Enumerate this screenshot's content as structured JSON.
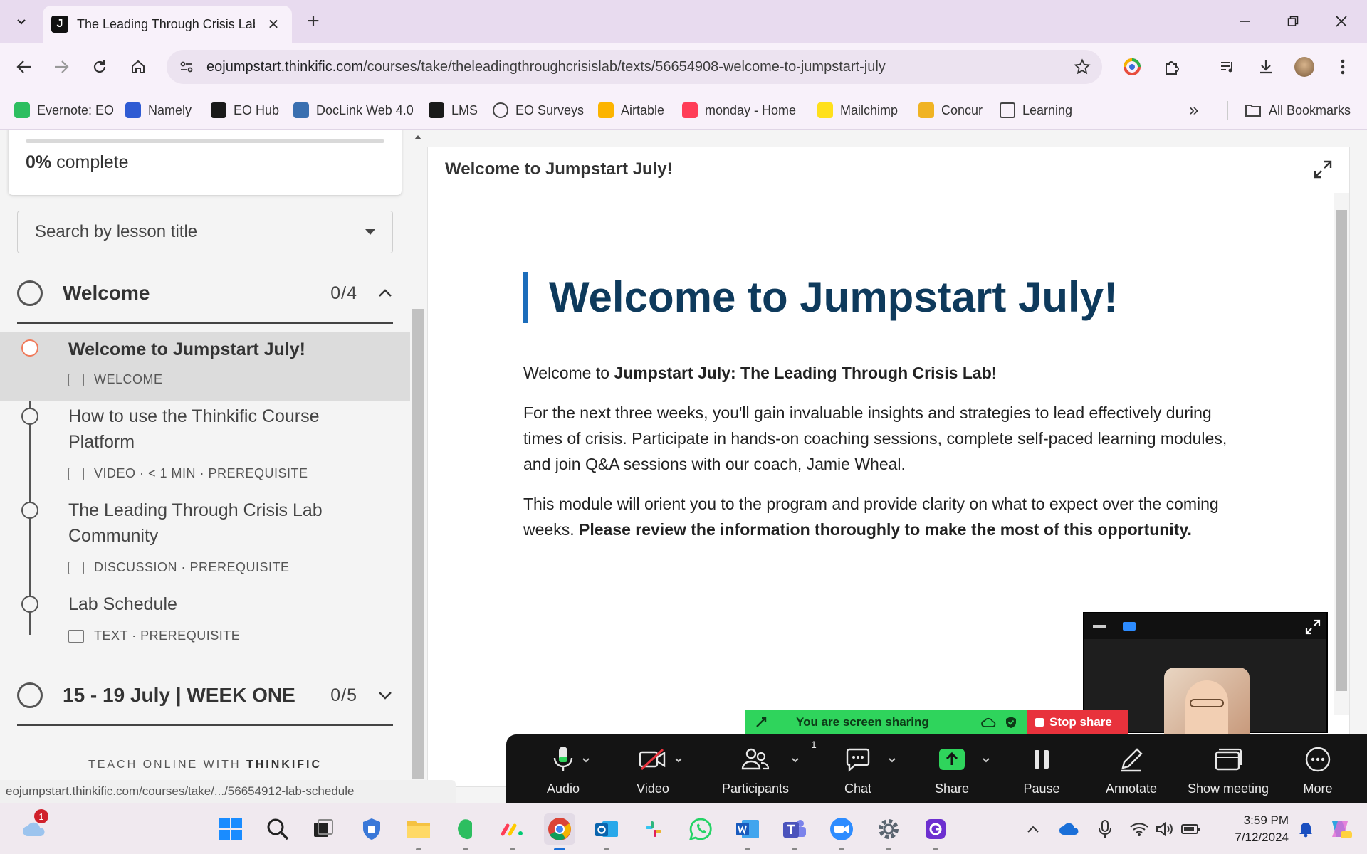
{
  "browser": {
    "tab_title": "The Leading Through Crisis Lab",
    "tab_favicon": "J",
    "url_host": "eojumpstart.thinkific.com",
    "url_path": "/courses/take/theleadingthroughcrisislab/texts/56654908-welcome-to-jumpstart-july",
    "bookmarks": [
      {
        "label": "Evernote: EO",
        "icon": "evernote-icon",
        "color": "#2dbe60"
      },
      {
        "label": "Namely",
        "icon": "namely-icon",
        "color": "#2f5bd3"
      },
      {
        "label": "EO Hub",
        "icon": "eo-hub-icon",
        "color": "#1a1a1a"
      },
      {
        "label": "DocLink Web 4.0",
        "icon": "doclink-icon",
        "color": "#3a6fb0"
      },
      {
        "label": "LMS",
        "icon": "lms-icon",
        "color": "#1a1a1a"
      },
      {
        "label": "EO Surveys",
        "icon": "globe-icon",
        "color": "#444444"
      },
      {
        "label": "Airtable",
        "icon": "airtable-icon",
        "color": "#fcb400"
      },
      {
        "label": "monday - Home",
        "icon": "monday-icon",
        "color": "#ff3d57"
      },
      {
        "label": "Mailchimp",
        "icon": "mailchimp-icon",
        "color": "#ffe01b"
      },
      {
        "label": "Concur",
        "icon": "concur-icon",
        "color": "#f0b323"
      },
      {
        "label": "Learning",
        "icon": "folder-icon",
        "color": "#444444"
      }
    ],
    "all_bookmarks": "All Bookmarks",
    "overflow": "»"
  },
  "sidebar": {
    "progress_value": "0%",
    "progress_text": " complete",
    "progress_fraction": 0,
    "search_placeholder": "Search by lesson title",
    "chapters": [
      {
        "title": "Welcome",
        "count": "0/4",
        "expanded": true
      },
      {
        "title": "15 - 19 July | WEEK ONE",
        "count": "0/5",
        "expanded": false
      }
    ],
    "lessons": [
      {
        "title": "Welcome to Jumpstart July!",
        "meta": "WELCOME",
        "active": true
      },
      {
        "title": "How to use the Thinkific Course Platform",
        "meta": "VIDEO · < 1 MIN · PREREQUISITE"
      },
      {
        "title": "The Leading Through Crisis Lab Community",
        "meta": "DISCUSSION · PREREQUISITE"
      },
      {
        "title": "Lab Schedule",
        "meta": "TEXT · PREREQUISITE"
      }
    ],
    "footer_prefix": "TEACH ONLINE WITH ",
    "footer_brand": "THINKIFIC"
  },
  "content": {
    "header_title": "Welcome to Jumpstart July!",
    "heading": "Welcome to Jumpstart July!",
    "p1_prefix": "Welcome to ",
    "p1_bold": "Jumpstart July: The Leading Through Crisis Lab",
    "p1_suffix": "!",
    "p2": "For the next three weeks, you'll gain invaluable insights and strategies to lead effectively during times of crisis. Participate in hands-on coaching sessions, complete self-paced learning modules, and join Q&A sessions with our coach, Jamie Wheal.",
    "p3_prefix": "This module will orient you to the program and provide clarity on what to expect over the coming weeks. ",
    "p3_bold": "Please review the information thoroughly to make the most of this opportunity.",
    "accent_color": "#1c6dbb",
    "heading_color": "#0e3a5c"
  },
  "status_url": "eojumpstart.thinkific.com/courses/take/.../56654912-lab-schedule",
  "zoom": {
    "sharing_text": "You are screen sharing",
    "stop_share": "Stop share",
    "participants_count": "1",
    "buttons": [
      {
        "label": "Audio",
        "icon": "microphone-icon"
      },
      {
        "label": "Video",
        "icon": "video-off-icon"
      },
      {
        "label": "Participants",
        "icon": "participants-icon"
      },
      {
        "label": "Chat",
        "icon": "chat-icon"
      },
      {
        "label": "Share",
        "icon": "share-screen-icon"
      },
      {
        "label": "Pause",
        "icon": "pause-icon"
      },
      {
        "label": "Annotate",
        "icon": "pencil-icon"
      },
      {
        "label": "Show meeting",
        "icon": "show-meeting-icon"
      },
      {
        "label": "More",
        "icon": "more-icon"
      }
    ]
  },
  "taskbar": {
    "time": "3:59 PM",
    "date": "7/12/2024",
    "weather_badge": "1"
  }
}
